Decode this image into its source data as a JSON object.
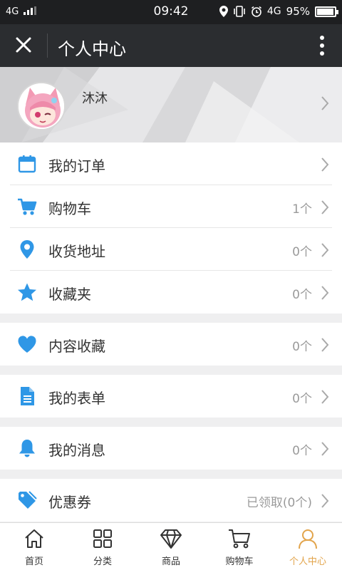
{
  "status_bar": {
    "network": "4G",
    "time": "09:42",
    "data_network": "4G",
    "battery": "95%",
    "battery_level": 0.95
  },
  "header": {
    "title": "个人中心",
    "close_icon": "close-icon",
    "more_icon": "more-vertical-icon"
  },
  "profile": {
    "username": "沐沐",
    "avatar_icon": "avatar"
  },
  "menu": [
    {
      "label": "我的订单",
      "count": "",
      "icon": "calendar-icon"
    },
    {
      "label": "购物车",
      "count": "1个",
      "icon": "cart-icon"
    },
    {
      "label": "收货地址",
      "count": "0个",
      "icon": "location-pin-icon"
    },
    {
      "label": "收藏夹",
      "count": "0个",
      "icon": "star-icon"
    },
    {
      "label": "内容收藏",
      "count": "0个",
      "icon": "heart-icon"
    },
    {
      "label": "我的表单",
      "count": "0个",
      "icon": "document-icon"
    },
    {
      "label": "我的消息",
      "count": "0个",
      "icon": "bell-icon"
    },
    {
      "label": "优惠券",
      "count": "已领取(0个)",
      "icon": "tag-icon"
    }
  ],
  "bottom_nav": [
    {
      "label": "首页",
      "icon": "home-icon"
    },
    {
      "label": "分类",
      "icon": "category-icon"
    },
    {
      "label": "商品",
      "icon": "diamond-icon"
    },
    {
      "label": "购物车",
      "icon": "cart-icon"
    },
    {
      "label": "个人中心",
      "icon": "person-icon",
      "active": true
    }
  ],
  "colors": {
    "accent": "#2f97e6",
    "active_tab": "#e2a44b",
    "header_bg": "#2b2d30",
    "status_bg": "#1e1f21"
  }
}
